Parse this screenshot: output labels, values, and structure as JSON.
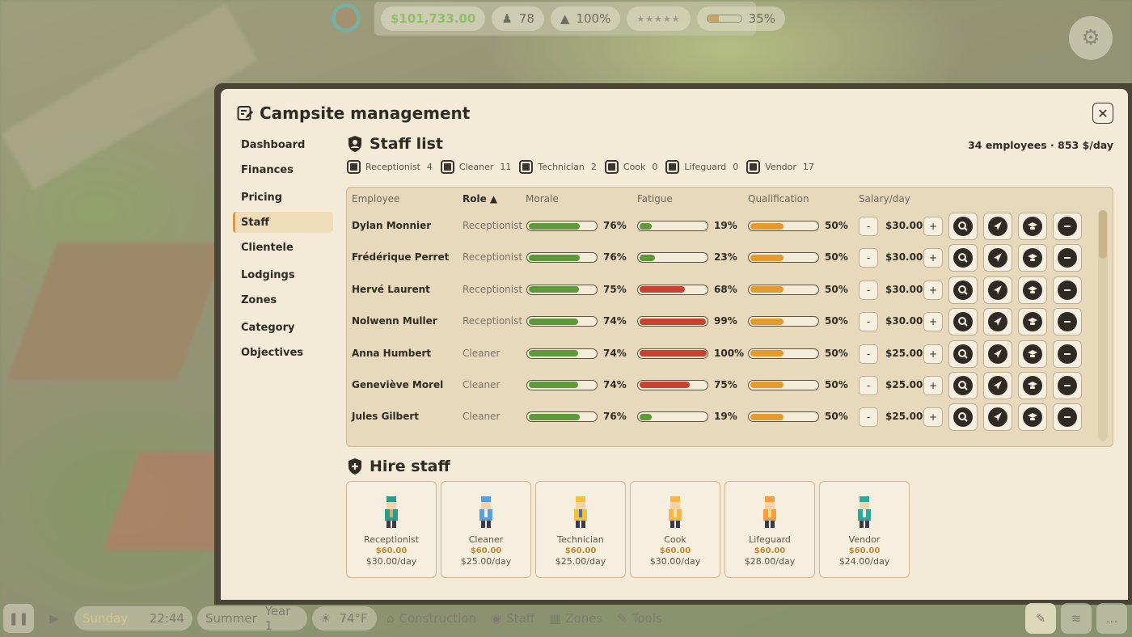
{
  "hud": {
    "money": "$101,733.00",
    "visitors": "78",
    "satisfaction": "100%",
    "rating_stars": "★★★★★",
    "progress_value": 35,
    "progress_label": "35%"
  },
  "bottom_bar": {
    "day": "Sunday",
    "time": "22:44",
    "season": "Summer",
    "year": "Year 1",
    "temperature": "74°F",
    "construction": "Construction",
    "staff": "Staff",
    "zones": "Zones",
    "tools": "Tools"
  },
  "modal": {
    "title": "Campsite management",
    "close_label": "✕",
    "nav": [
      {
        "label": "Dashboard"
      },
      {
        "label": "Finances"
      },
      {
        "label": "Pricing"
      },
      {
        "label": "Staff"
      },
      {
        "label": "Clientele"
      },
      {
        "label": "Lodgings"
      },
      {
        "label": "Zones"
      },
      {
        "label": "Category"
      },
      {
        "label": "Objectives"
      }
    ],
    "staff_list_title": "Staff list",
    "summary": "34 employees · 853 $/day",
    "filters": [
      {
        "label": "Receptionist",
        "count": "4"
      },
      {
        "label": "Cleaner",
        "count": "11"
      },
      {
        "label": "Technician",
        "count": "2"
      },
      {
        "label": "Cook",
        "count": "0"
      },
      {
        "label": "Lifeguard",
        "count": "0"
      },
      {
        "label": "Vendor",
        "count": "17"
      }
    ],
    "columns": {
      "employee": "Employee",
      "role": "Role ▲",
      "morale": "Morale",
      "fatigue": "Fatigue",
      "qualification": "Qualification",
      "salary": "Salary/day"
    },
    "minus": "-",
    "plus": "+",
    "rows": [
      {
        "name": "Dylan Monnier",
        "role": "Receptionist",
        "morale": 76,
        "morale_label": "76%",
        "fatigue": 19,
        "fatigue_label": "19%",
        "qualification": 50,
        "qualification_label": "50%",
        "salary": "$30.00"
      },
      {
        "name": "Frédérique Perret",
        "role": "Receptionist",
        "morale": 76,
        "morale_label": "76%",
        "fatigue": 23,
        "fatigue_label": "23%",
        "qualification": 50,
        "qualification_label": "50%",
        "salary": "$30.00"
      },
      {
        "name": "Hervé Laurent",
        "role": "Receptionist",
        "morale": 75,
        "morale_label": "75%",
        "fatigue": 68,
        "fatigue_label": "68%",
        "qualification": 50,
        "qualification_label": "50%",
        "salary": "$30.00"
      },
      {
        "name": "Nolwenn Muller",
        "role": "Receptionist",
        "morale": 74,
        "morale_label": "74%",
        "fatigue": 99,
        "fatigue_label": "99%",
        "qualification": 50,
        "qualification_label": "50%",
        "salary": "$30.00"
      },
      {
        "name": "Anna Humbert",
        "role": "Cleaner",
        "morale": 74,
        "morale_label": "74%",
        "fatigue": 100,
        "fatigue_label": "100%",
        "qualification": 50,
        "qualification_label": "50%",
        "salary": "$25.00"
      },
      {
        "name": "Geneviève Morel",
        "role": "Cleaner",
        "morale": 74,
        "morale_label": "74%",
        "fatigue": 75,
        "fatigue_label": "75%",
        "qualification": 50,
        "qualification_label": "50%",
        "salary": "$25.00"
      },
      {
        "name": "Jules Gilbert",
        "role": "Cleaner",
        "morale": 76,
        "morale_label": "76%",
        "fatigue": 19,
        "fatigue_label": "19%",
        "qualification": 50,
        "qualification_label": "50%",
        "salary": "$25.00"
      }
    ],
    "hire_title": "Hire staff",
    "hire": [
      {
        "role": "Receptionist",
        "price": "$60.00",
        "salary": "$30.00/day"
      },
      {
        "role": "Cleaner",
        "price": "$60.00",
        "salary": "$25.00/day"
      },
      {
        "role": "Technician",
        "price": "$60.00",
        "salary": "$25.00/day"
      },
      {
        "role": "Cook",
        "price": "$60.00",
        "salary": "$30.00/day"
      },
      {
        "role": "Lifeguard",
        "price": "$60.00",
        "salary": "$28.00/day"
      },
      {
        "role": "Vendor",
        "price": "$60.00",
        "salary": "$24.00/day"
      }
    ]
  },
  "colors": {
    "morale": "#5f9a3a",
    "fatigue_low": "#5f9a3a",
    "fatigue_high": "#c8432f",
    "qualification": "#e59a2e",
    "accent": "#d69b4a"
  }
}
